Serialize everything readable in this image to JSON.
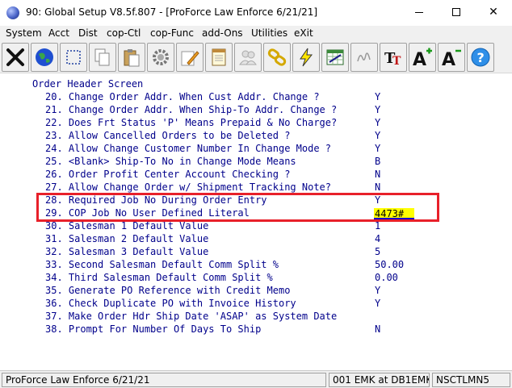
{
  "window": {
    "title": "90: Global Setup V8.5f.807 - [ProForce Law Enforce 6/21/21]",
    "icon": "app-globe-icon"
  },
  "menu": {
    "items": [
      {
        "label": "System"
      },
      {
        "label": "Acct"
      },
      {
        "label": "Dist"
      },
      {
        "label": "cop-Ctl"
      },
      {
        "label": "cop-Func"
      },
      {
        "label": "add-Ons"
      },
      {
        "label": "Utilities"
      },
      {
        "label": "eXit"
      }
    ]
  },
  "toolbar": {
    "buttons": [
      {
        "icon": "close-x-icon"
      },
      {
        "icon": "globe-icon"
      },
      {
        "icon": "select-rectangle-icon"
      },
      {
        "icon": "copy-icon"
      },
      {
        "icon": "paste-icon"
      },
      {
        "icon": "settings-gear-icon"
      },
      {
        "icon": "edit-pencil-icon"
      },
      {
        "icon": "notepad-icon"
      },
      {
        "icon": "users-icon"
      },
      {
        "icon": "chain-link-icon"
      },
      {
        "icon": "lightning-icon"
      },
      {
        "icon": "spreadsheet-icon"
      },
      {
        "icon": "signature-icon"
      },
      {
        "icon": "font-tt-icon"
      },
      {
        "icon": "font-increase-icon"
      },
      {
        "icon": "font-decrease-icon"
      },
      {
        "icon": "help-icon"
      }
    ]
  },
  "screen": {
    "title": "Order Header Screen",
    "rows": [
      {
        "label": "20. Change Order Addr. When Cust Addr. Change ?",
        "value": "Y"
      },
      {
        "label": "21. Change Order Addr. When Ship-To Addr. Change ?",
        "value": "Y"
      },
      {
        "label": "22. Does Frt Status 'P' Means Prepaid & No Charge?",
        "value": "Y"
      },
      {
        "label": "23. Allow Cancelled Orders to be Deleted ?",
        "value": "Y"
      },
      {
        "label": "24. Allow Change Customer Number In Change Mode ?",
        "value": "Y"
      },
      {
        "label": "25. <Blank> Ship-To No in Change Mode Means",
        "value": "B"
      },
      {
        "label": "26. Order Profit Center Account Checking ?",
        "value": "N"
      },
      {
        "label": "27. Allow Change Order w/ Shipment Tracking Note?",
        "value": "N"
      },
      {
        "label": "28. Required Job No During Order Entry",
        "value": "Y"
      },
      {
        "label": "29. COP Job No User Defined Literal",
        "value": ""
      },
      {
        "label": "30. Salesman 1 Default Value",
        "value": "1"
      },
      {
        "label": "31. Salesman 2 Default Value",
        "value": "4"
      },
      {
        "label": "32. Salesman 3 Default Value",
        "value": "5"
      },
      {
        "label": "33. Second Salesman Default Comm Split %",
        "value": "50.00"
      },
      {
        "label": "34. Third Salesman Default Comm Split %",
        "value": "0.00"
      },
      {
        "label": "35. Generate PO Reference with Credit Memo",
        "value": "Y"
      },
      {
        "label": "36. Check Duplicate PO with Invoice History",
        "value": "Y"
      },
      {
        "label": "37. Make Order Hdr Ship Date 'ASAP' as System Date",
        "value": ""
      },
      {
        "label": "38. Prompt For Number Of Days To Ship",
        "value": "N"
      }
    ],
    "active_input": {
      "value": "4473#"
    },
    "highlight_color": "#e8202a",
    "text_color": "#00008b",
    "input_bg": "#ffff00"
  },
  "status": {
    "company": "ProForce Law Enforce 6/21/21",
    "session": "001 EMK at DB1EMK",
    "machine": "NSCTLMN5"
  }
}
